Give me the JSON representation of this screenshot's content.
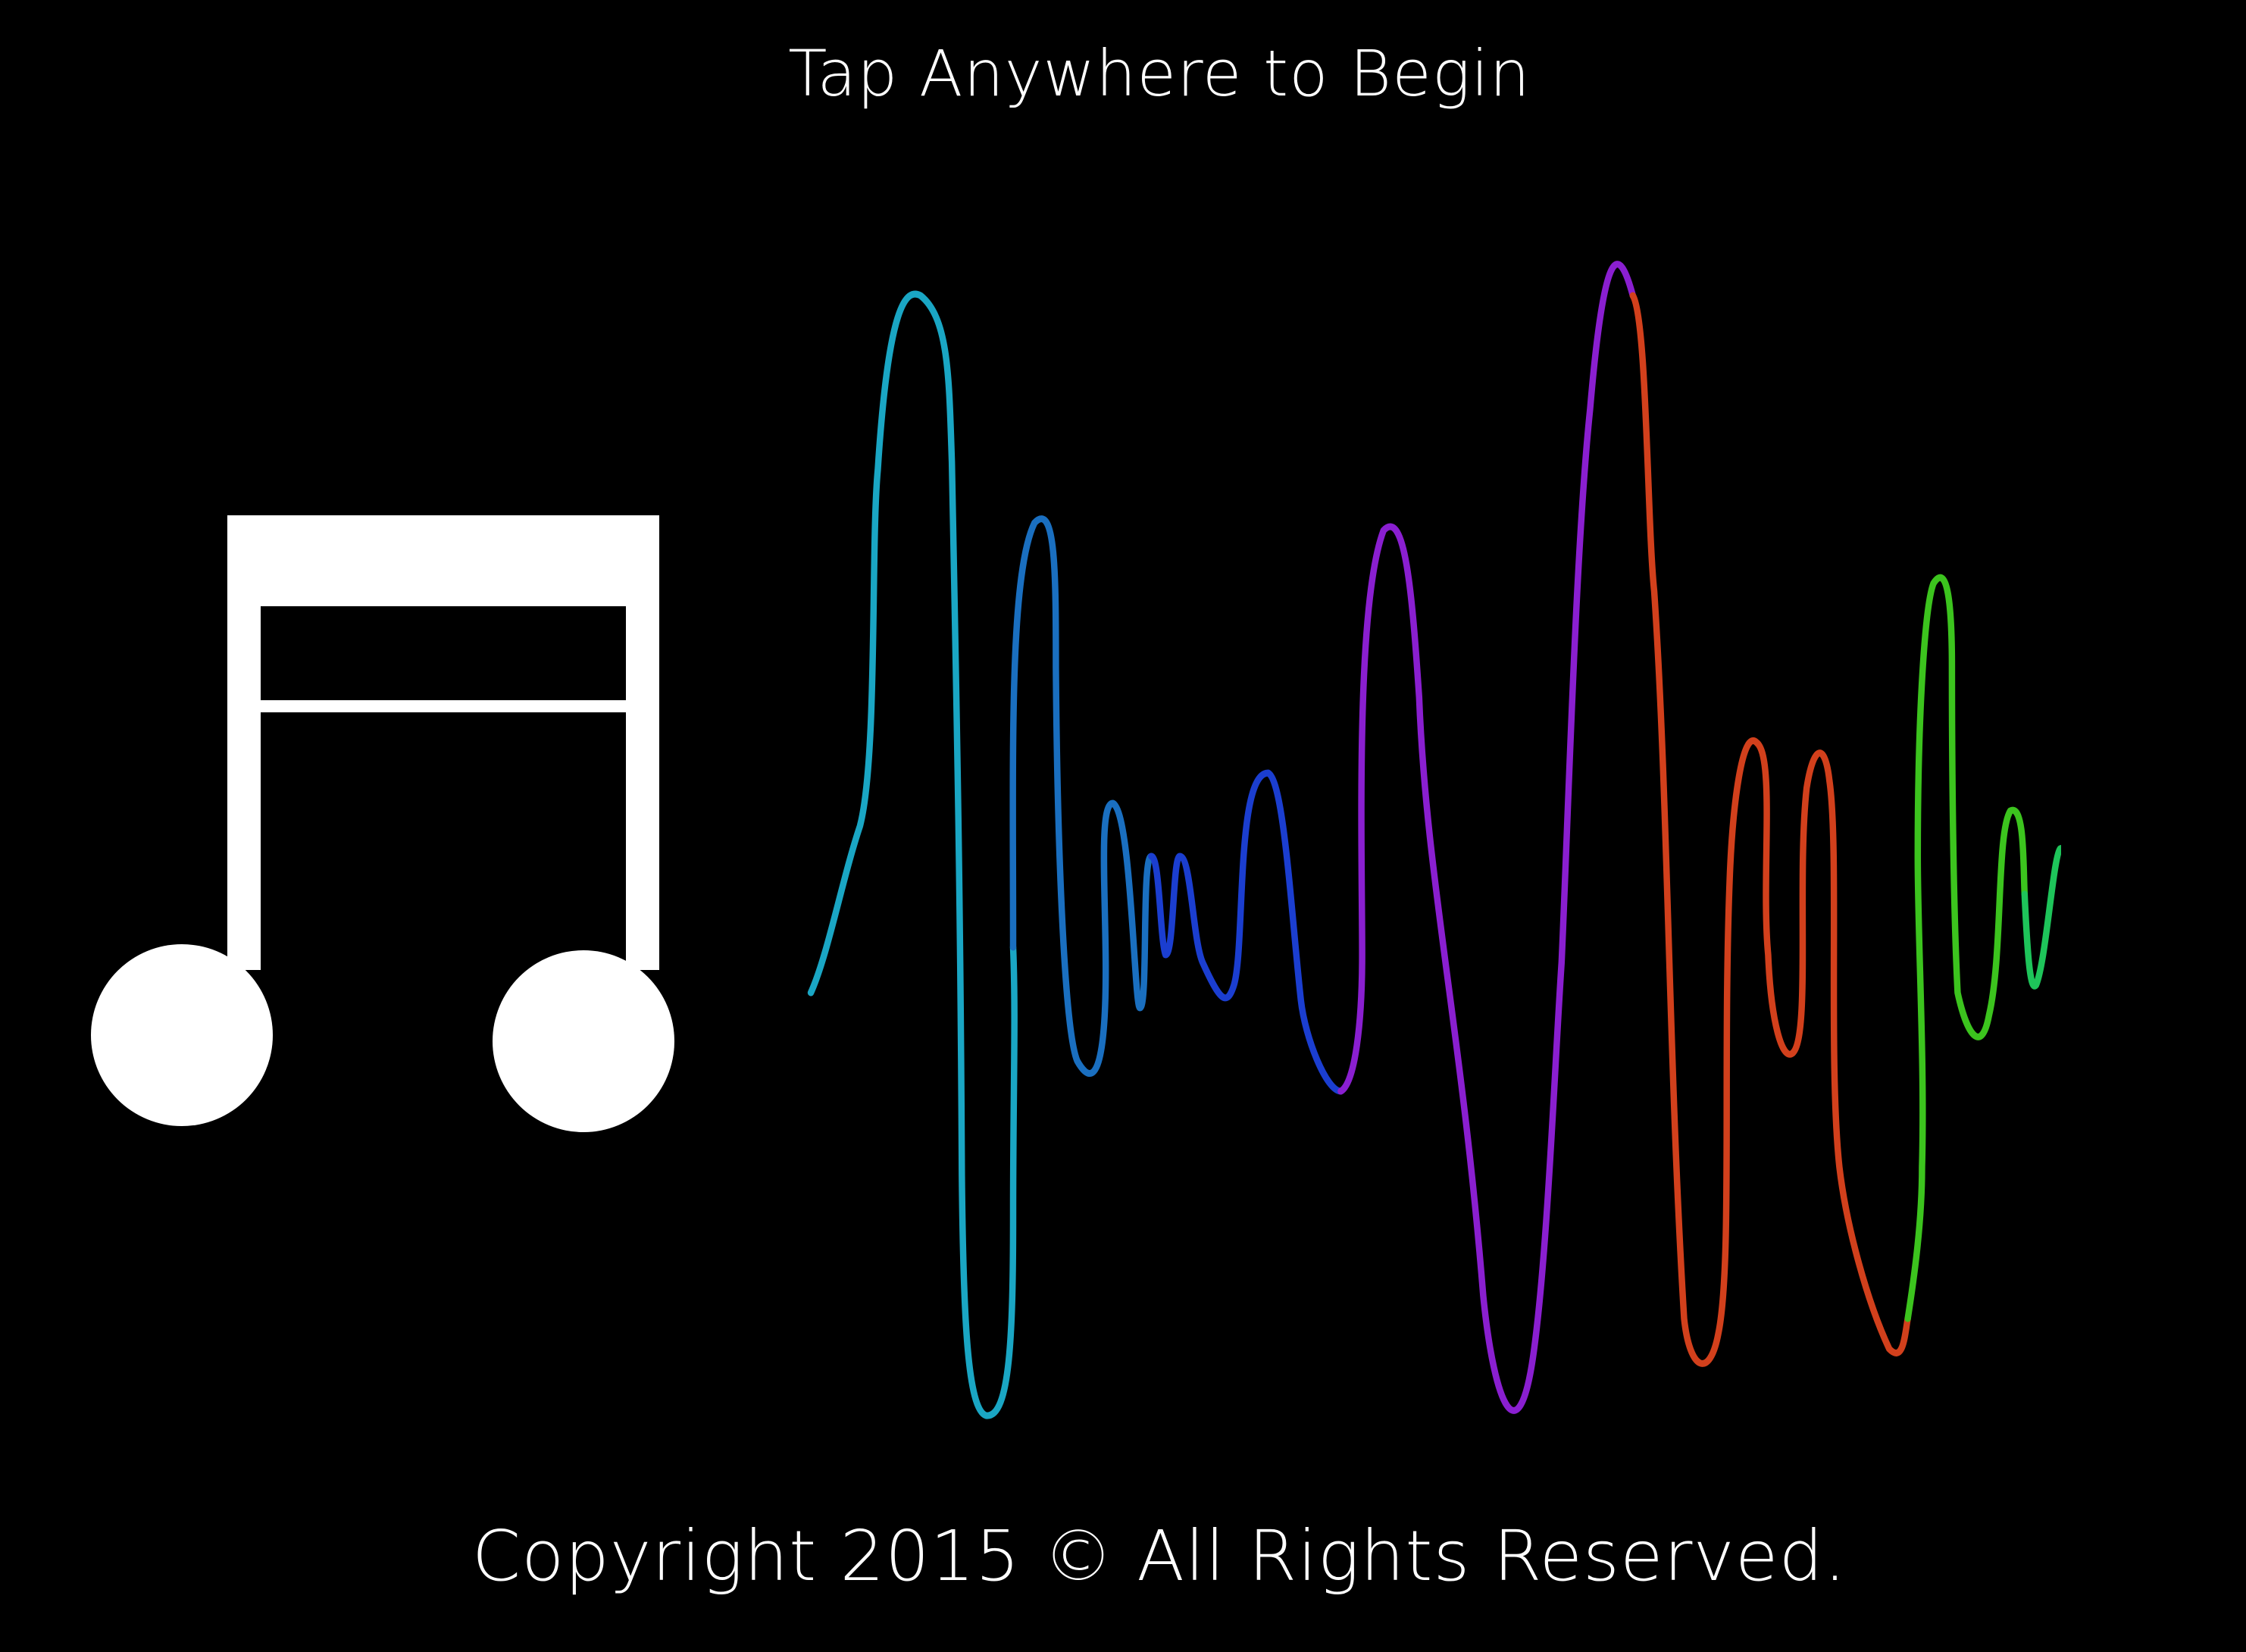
{
  "screen": {
    "background": "#000000",
    "prompt": "Tap Anywhere to Begin",
    "copyright": "Copyright 2015 © All Rights Reserved."
  },
  "logo": {
    "icon": "beamed-eighth-notes-icon",
    "color": "#ffffff"
  },
  "waveform": {
    "icon": "sound-wave",
    "segment_colors": [
      "#1aa6c4",
      "#1a6fc0",
      "#1b3ed0",
      "#8a1fd0",
      "#d2401c",
      "#3cc41e",
      "#1ec45a"
    ]
  }
}
